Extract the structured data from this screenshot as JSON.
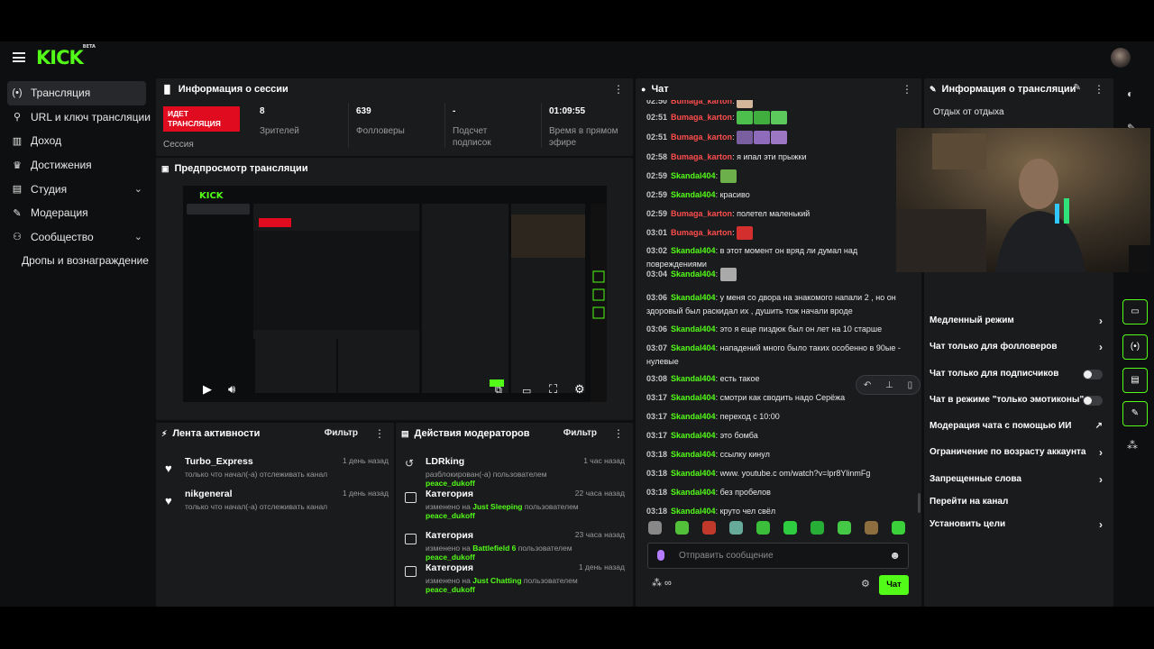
{
  "brand": {
    "logo": "KICK",
    "badge": "BETA"
  },
  "sidebar": {
    "items": [
      {
        "icon": "(•)",
        "label": "Трансляция",
        "active": true
      },
      {
        "icon": "⚲",
        "label": "URL и ключ трансляции"
      },
      {
        "icon": "▥",
        "label": "Доход"
      },
      {
        "icon": "♛",
        "label": "Достижения"
      },
      {
        "icon": "▤",
        "label": "Студия",
        "chevron": "⌄"
      },
      {
        "icon": "✎",
        "label": "Модерация"
      },
      {
        "icon": "⚇",
        "label": "Сообщество",
        "chevron": "⌄"
      },
      {
        "icon": "",
        "label": "Дропы и вознаграждение"
      }
    ]
  },
  "session": {
    "title": "Информация о сессии",
    "live": "ИДЕТ ТРАНСЛЯЦИЯ",
    "session_label": "Сессия",
    "stats": [
      {
        "value": "8",
        "label": "Зрителей"
      },
      {
        "value": "639",
        "label": "Фолловеры"
      },
      {
        "value": "-",
        "label": "Подсчет подписок"
      },
      {
        "value": "01:09:55",
        "label": "Время в прямом эфире"
      }
    ]
  },
  "preview": {
    "title": "Предпросмотр трансляции"
  },
  "activity": {
    "title": "Лента активности",
    "filter": "Фильтр",
    "items": [
      {
        "name": "Turbo_Express",
        "desc": "только что начал(-а) отслеживать канал",
        "time": "1 день назад"
      },
      {
        "name": "nikgeneral",
        "desc": "только что начал(-а) отслеживать канал",
        "time": "1 день назад"
      }
    ]
  },
  "modlog": {
    "title": "Действия модераторов",
    "filter": "Фильтр",
    "items": [
      {
        "name": "LDRking",
        "pre": "разблокирован(-а) пользователем",
        "hl1": "peace_dukoff",
        "mid": "",
        "hl2": "",
        "time": "1 час назад"
      },
      {
        "name": "Категория",
        "pre": "изменено на",
        "hl1": "Just Sleeping",
        "mid": "пользователем",
        "hl2": "peace_dukoff",
        "time": "22 часа назад"
      },
      {
        "name": "Категория",
        "pre": "изменено на",
        "hl1": "Battlefield 6",
        "mid": "пользователем",
        "hl2": "peace_dukoff",
        "time": "23 часа назад"
      },
      {
        "name": "Категория",
        "pre": "изменено на",
        "hl1": "Just Chatting",
        "mid": "пользователем",
        "hl2": "peace_dukoff",
        "time": "1 день назад"
      }
    ]
  },
  "chat": {
    "title": "Чат",
    "placeholder": "Отправить сообщение",
    "send": "Чат",
    "messages": [
      {
        "time": "02:50",
        "user": "Bumaga_karton",
        "color": "r",
        "text": ""
      },
      {
        "time": "02:51",
        "user": "Bumaga_karton",
        "color": "r",
        "text": ""
      },
      {
        "time": "02:51",
        "user": "Bumaga_karton",
        "color": "r",
        "text": ""
      },
      {
        "time": "02:58",
        "user": "Bumaga_karton",
        "color": "r",
        "text": "я ипал эти прыжки"
      },
      {
        "time": "02:59",
        "user": "Skandal404",
        "color": "g",
        "text": ""
      },
      {
        "time": "02:59",
        "user": "Skandal404",
        "color": "g",
        "text": "красиво"
      },
      {
        "time": "02:59",
        "user": "Bumaga_karton",
        "color": "r",
        "text": "полетел маленький"
      },
      {
        "time": "03:01",
        "user": "Bumaga_karton",
        "color": "r",
        "text": ""
      },
      {
        "time": "03:02",
        "user": "Skandal404",
        "color": "g",
        "text": "в этот момент он вряд ли думал над повреждениями"
      },
      {
        "time": "03:04",
        "user": "Skandal404",
        "color": "g",
        "text": ""
      },
      {
        "time": "03:06",
        "user": "Skandal404",
        "color": "g",
        "text": "у меня со двора на знакомого напали 2 , но он здоровый был раскидал их , душить тож начали вроде"
      },
      {
        "time": "03:06",
        "user": "Skandal404",
        "color": "g",
        "text": "это я еще пиздюк был он лет на 10 старше"
      },
      {
        "time": "03:07",
        "user": "Skandal404",
        "color": "g",
        "text": "нападений много было таких особенно в 90ые - нулевые"
      },
      {
        "time": "03:08",
        "user": "Skandal404",
        "color": "g",
        "text": "есть такое"
      },
      {
        "time": "03:17",
        "user": "Skandal404",
        "color": "g",
        "text": "смотри как сводить надо Серёжа"
      },
      {
        "time": "03:17",
        "user": "Skandal404",
        "color": "g",
        "text": "переход с 10:00"
      },
      {
        "time": "03:17",
        "user": "Skandal404",
        "color": "g",
        "text": "это бомба"
      },
      {
        "time": "03:18",
        "user": "Skandal404",
        "color": "g",
        "text": "ссылку кинул"
      },
      {
        "time": "03:18",
        "user": "Skandal404",
        "color": "g",
        "text": "www. youtube.c om/watch?v=lpr8YlinmFg"
      },
      {
        "time": "03:18",
        "user": "Skandal404",
        "color": "g",
        "text": "без пробелов"
      },
      {
        "time": "03:18",
        "user": "Skandal404",
        "color": "g",
        "text": "круто чел свёл"
      }
    ]
  },
  "stream_info": {
    "title": "Информация о трансляции",
    "stream_title": "Отдых от отдыха",
    "options": [
      {
        "label": "Медленный режим",
        "kind": "arrow"
      },
      {
        "label": "Чат только для фолловеров",
        "kind": "arrow"
      },
      {
        "label": "Чат только для подписчиков",
        "kind": "toggle"
      },
      {
        "label": "Чат в режиме \"только эмотиконы\"",
        "kind": "toggle"
      },
      {
        "label": "Модерация чата с помощью ИИ",
        "kind": "ext"
      },
      {
        "label": "Ограничение по возрасту аккаунта",
        "kind": "arrow"
      },
      {
        "label": "Запрещенные слова",
        "kind": "arrow"
      },
      {
        "label": "Перейти на канал",
        "kind": "none"
      },
      {
        "label": "Установить цели",
        "kind": "arrow"
      }
    ]
  },
  "colors": {
    "accent": "#53fc18",
    "live": "#e10b1f",
    "panel": "#1a1b1d",
    "bg": "#0e0f10"
  }
}
